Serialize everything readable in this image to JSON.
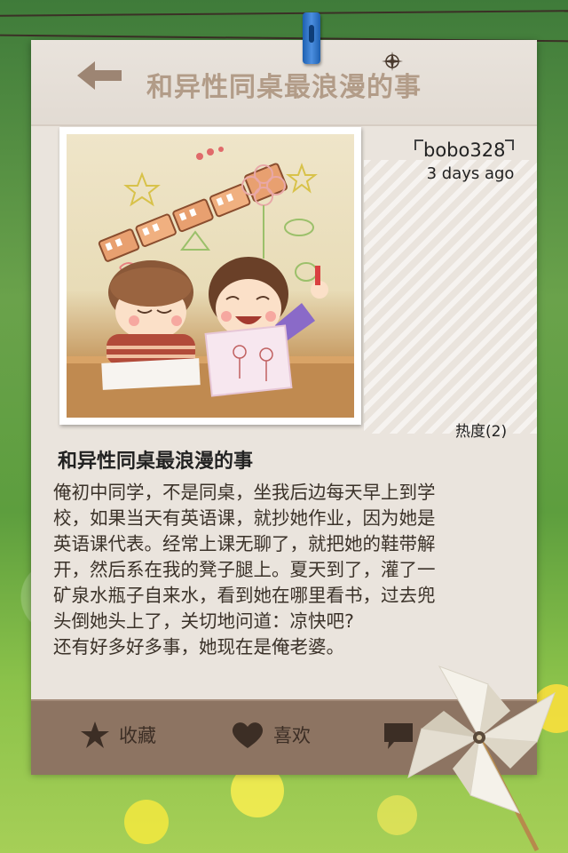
{
  "header": {
    "title": "和异性同桌最浪漫的事"
  },
  "post": {
    "author": "bobo328",
    "time_ago": "3 days ago",
    "heat_label": "热度(2)",
    "headline": "和异性同桌最浪漫的事",
    "body_lines": [
      "俺初中同学，不是同桌，坐我后边每天早上到学",
      "校，如果当天有英语课，就抄她作业，因为她是",
      "英语课代表。经常上课无聊了，就把她的鞋带解",
      "开，然后系在我的凳子腿上。夏天到了，灌了一",
      "矿泉水瓶子自来水，看到她在哪里看书，过去兜",
      "头倒她头上了，关切地问道：凉快吧?",
      "还有好多好多事，她现在是俺老婆。"
    ]
  },
  "footer": {
    "favorite_label": "收藏",
    "like_label": "喜欢",
    "comment_label": ""
  },
  "icons": {
    "back": "back-arrow-icon",
    "favorite": "star-icon",
    "like": "heart-icon",
    "comment": "speech-bubble-icon"
  },
  "colors": {
    "card": "#eae4dd",
    "title": "#b29c88",
    "footer": "#8d7462",
    "icon": "#3c2e25"
  }
}
